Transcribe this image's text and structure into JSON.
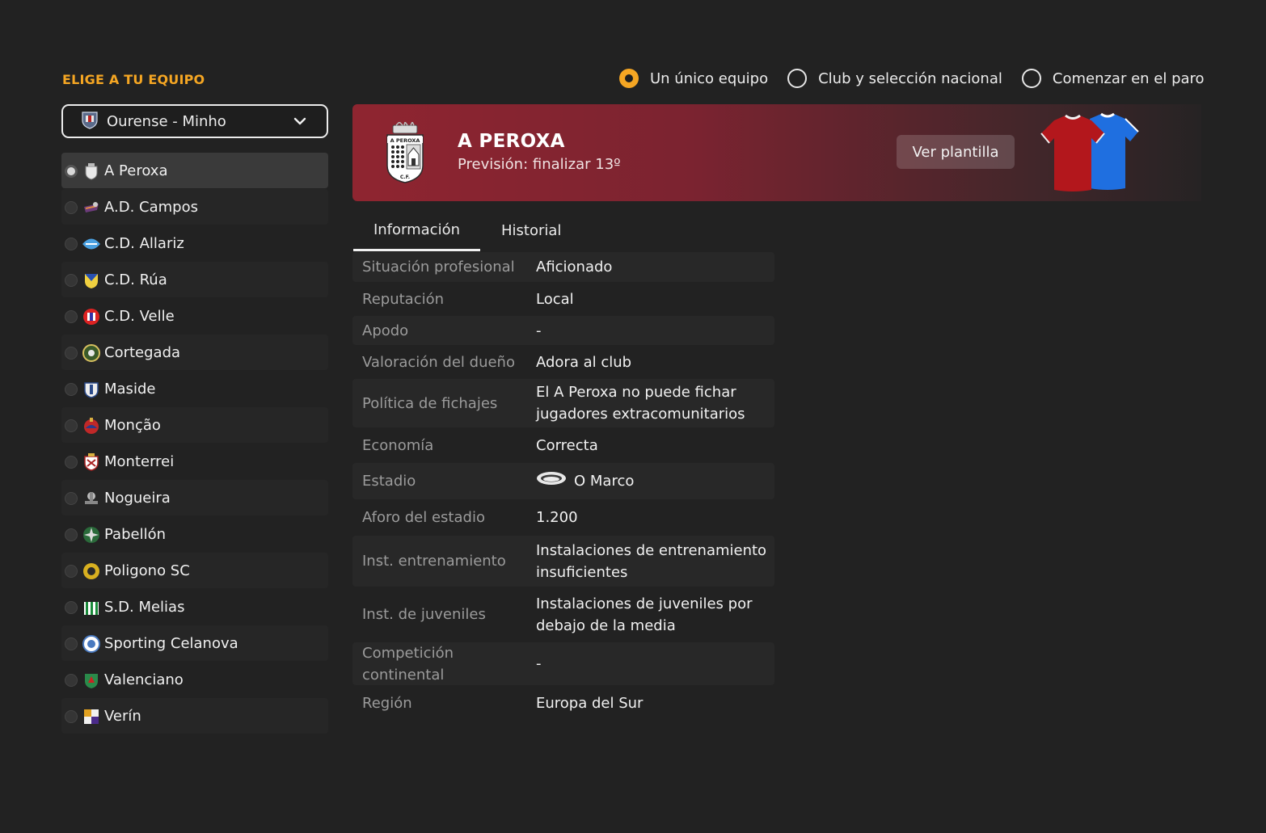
{
  "page": {
    "heading": "ELIGE A TU EQUIPO"
  },
  "mode_options": [
    {
      "label": "Un único equipo",
      "selected": true
    },
    {
      "label": "Club y selección nacional",
      "selected": false
    },
    {
      "label": "Comenzar en el paro",
      "selected": false
    }
  ],
  "region_select": {
    "value": "Ourense - Minho",
    "icon": "region-crest-icon"
  },
  "teams": [
    {
      "name": "A Peroxa",
      "selected": true
    },
    {
      "name": "A.D. Campos"
    },
    {
      "name": "C.D. Allariz"
    },
    {
      "name": "C.D. Rúa"
    },
    {
      "name": "C.D. Velle"
    },
    {
      "name": "Cortegada"
    },
    {
      "name": "Maside"
    },
    {
      "name": "Monção"
    },
    {
      "name": "Monterrei"
    },
    {
      "name": "Nogueira"
    },
    {
      "name": "Pabellón"
    },
    {
      "name": "Poligono SC"
    },
    {
      "name": "S.D. Melias"
    },
    {
      "name": "Sporting Celanova"
    },
    {
      "name": "Valenciano"
    },
    {
      "name": "Verín"
    }
  ],
  "club": {
    "name": "A PEROXA",
    "prediction": "Previsión: finalizar 13º",
    "squad_button": "Ver plantilla",
    "crest_text": "A PEROXA",
    "crest_footer": "C.F.",
    "kit_colors": {
      "home": "#b3171c",
      "away": "#1f6fe0"
    }
  },
  "tabs": [
    {
      "label": "Información",
      "active": true
    },
    {
      "label": "Historial",
      "active": false
    }
  ],
  "info": [
    {
      "label": "Situación profesional",
      "value": "Aficionado"
    },
    {
      "label": "Reputación",
      "value": "Local"
    },
    {
      "label": "Apodo",
      "value": "-"
    },
    {
      "label": "Valoración del dueño",
      "value": "Adora al club"
    },
    {
      "label": "Política de fichajes",
      "value": "El A Peroxa no puede fichar jugadores extracomunitarios"
    },
    {
      "label": "Economía",
      "value": "Correcta"
    },
    {
      "label": "Estadio",
      "value": "O Marco",
      "icon": "stadium-icon"
    },
    {
      "label": "Aforo del estadio",
      "value": "1.200"
    },
    {
      "label": "Inst. entrenamiento",
      "value": "Instalaciones de entrenamiento insuficientes"
    },
    {
      "label": "Inst. de juveniles",
      "value": "Instalaciones de juveniles por debajo de la media"
    },
    {
      "label": "Competición continental",
      "value": "-"
    },
    {
      "label": "Región",
      "value": "Europa del Sur"
    }
  ],
  "colors": {
    "accent": "#f5a623",
    "background": "#222222",
    "banner": "#8f2530"
  }
}
